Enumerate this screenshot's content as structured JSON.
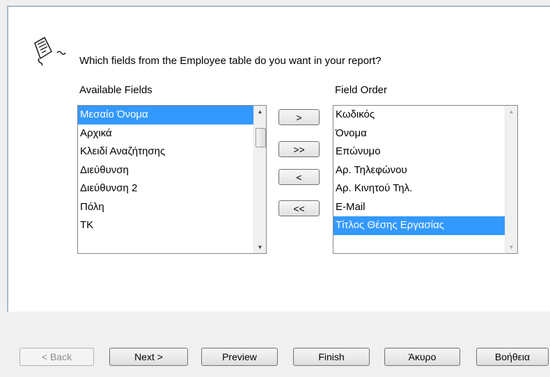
{
  "header": {
    "question": "Which fields from the Employee table do you want in your report?",
    "icon": "report-wizard-icon"
  },
  "available": {
    "label": "Available Fields",
    "items": [
      "Μεσαίο Όνομα",
      "Αρχικά",
      "Κλειδί Αναζήτησης",
      "Διεύθυνση",
      "Διεύθυνση 2",
      "Πόλη",
      "ΤΚ"
    ],
    "selected_index": 0
  },
  "order": {
    "label": "Field Order",
    "items": [
      "Κωδικός",
      "Όνομα",
      "Επώνυμο",
      "Αρ. Τηλεφώνου",
      "Αρ. Κινητού Τηλ.",
      "E-Mail",
      "Τίτλος Θέσης Εργασίας"
    ],
    "selected_index": 6
  },
  "move_buttons": {
    "add": ">",
    "add_all": ">>",
    "remove": "<",
    "remove_all": "<<"
  },
  "footer": {
    "back": "< Back",
    "next": "Next >",
    "preview": "Preview",
    "finish": "Finish",
    "cancel": "Άκυρο",
    "help": "Βοήθεια"
  },
  "colors": {
    "selection": "#3399ff",
    "panel_border": "#a8b8d0"
  }
}
